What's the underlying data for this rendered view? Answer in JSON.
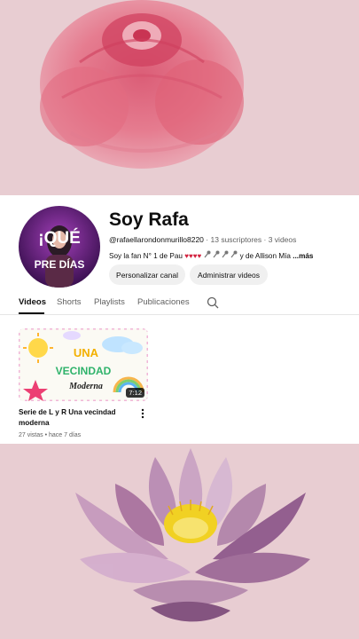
{
  "channel": {
    "name": "Soy Rafa",
    "handle": "@rafaellarondonmurillo8220",
    "subscribers": "13 suscriptores",
    "videos_count": "3 videos",
    "description_start": "Soy la fan N° 1 de Pau",
    "description_end": "y de Allison  Mía",
    "more_label": "...más",
    "avatar_text_top": "¡QUÉ",
    "avatar_text_bottom": "PRE  DÍAS"
  },
  "buttons": {
    "customize": "Personalizar canal",
    "manage": "Administrar videos"
  },
  "tabs": [
    "Videos",
    "Shorts",
    "Playlists",
    "Publicaciones"
  ],
  "video": {
    "thumb_line1": "UNA",
    "thumb_line2": "VECINDAD",
    "thumb_line3": "Moderna",
    "duration": "7:12",
    "title": "Serie de L y R Una vecindad moderna",
    "views": "27 vistas",
    "age": "hace 7 días"
  },
  "colors": {
    "wallpaper": "#e8cdd2",
    "heart": "#d21f3c",
    "text_primary": "#0f0f0f",
    "text_secondary": "#606060"
  },
  "icons": [
    "heart-icon",
    "microphone-icon",
    "search-icon",
    "more-vert-icon"
  ]
}
